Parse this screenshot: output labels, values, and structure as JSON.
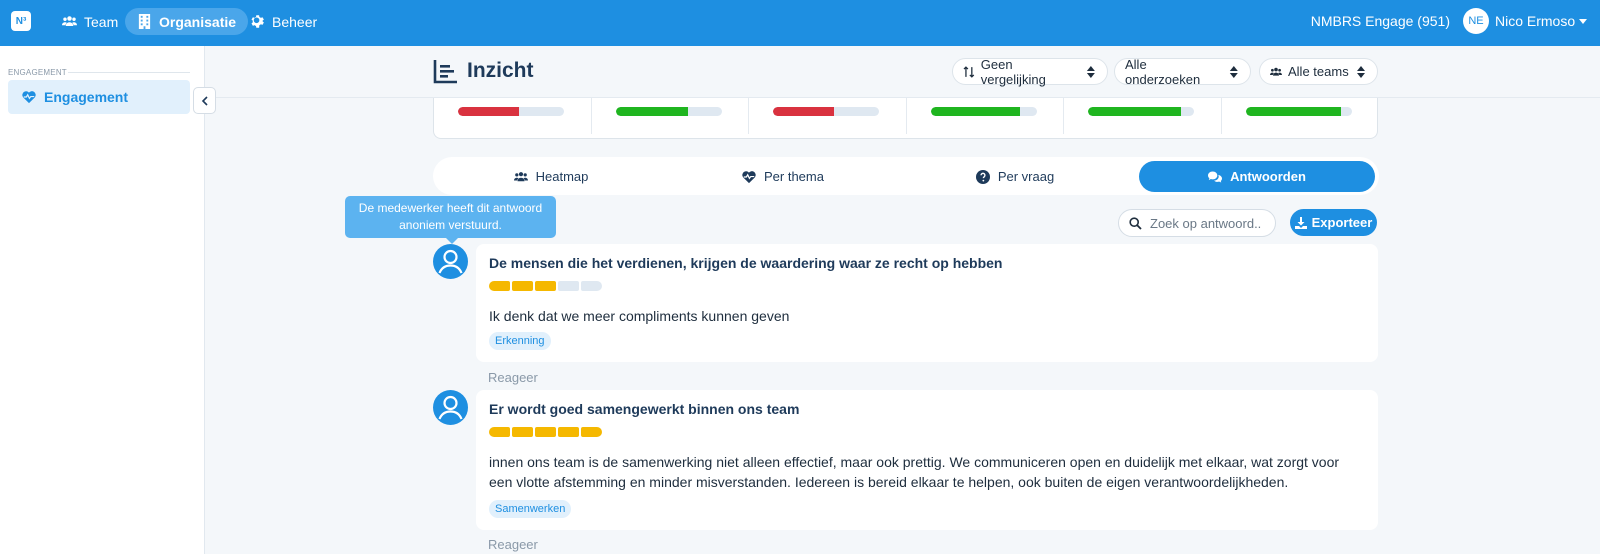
{
  "topbar": {
    "logo": "N³",
    "nav": [
      {
        "label": "Team",
        "icon": "users-icon",
        "active": false
      },
      {
        "label": "Organisatie",
        "icon": "building-icon",
        "active": true
      },
      {
        "label": "Beheer",
        "icon": "gear-icon",
        "active": false
      }
    ],
    "company": "NMBRS Engage (951)",
    "user_initials": "NE",
    "user_name": "Nico Ermoso"
  },
  "sidebar": {
    "section": "ENGAGEMENT",
    "items": [
      {
        "label": "Engagement",
        "icon": "heart-pulse-icon",
        "active": true
      }
    ]
  },
  "header": {
    "title": "Inzicht",
    "filters": [
      {
        "label": "Geen vergelijking",
        "icon": "sort-arrows-icon"
      },
      {
        "label": "Alle onderzoeken",
        "icon": ""
      },
      {
        "label": "Alle teams",
        "icon": "users-icon"
      }
    ]
  },
  "score_bars": [
    {
      "value": 0.58,
      "color": "#d9323f"
    },
    {
      "value": 0.68,
      "color": "#1fb51f"
    },
    {
      "value": 0.58,
      "color": "#d9323f"
    },
    {
      "value": 0.84,
      "color": "#1fb51f"
    },
    {
      "value": 0.88,
      "color": "#1fb51f"
    },
    {
      "value": 0.9,
      "color": "#1fb51f"
    }
  ],
  "tabs": [
    {
      "label": "Heatmap",
      "icon": "users-icon",
      "active": false
    },
    {
      "label": "Per thema",
      "icon": "heart-pulse-icon",
      "active": false
    },
    {
      "label": "Per vraag",
      "icon": "question-icon",
      "active": false
    },
    {
      "label": "Antwoorden",
      "icon": "comments-icon",
      "active": true
    }
  ],
  "tooltip": {
    "line1": "De medewerker heeft dit antwoord",
    "line2": "anoniem verstuurd."
  },
  "search": {
    "placeholder": "Zoek op antwoord.."
  },
  "export_label": "Exporteer",
  "answers": [
    {
      "question": "De mensen die het verdienen, krijgen de waardering waar ze recht op hebben",
      "rating": 3,
      "max": 5,
      "text": "Ik denk dat we meer compliments kunnen geven",
      "tag": "Erkenning",
      "reply": "Reageer"
    },
    {
      "question": "Er wordt goed samengewerkt binnen ons team",
      "rating": 5,
      "max": 5,
      "text": "innen ons team is de samenwerking niet alleen effectief, maar ook prettig. We communiceren open en duidelijk met elkaar, wat zorgt voor een vlotte afstemming en minder misverstanden. Iedereen is bereid elkaar te helpen, ook buiten de eigen verantwoordelijkheden.",
      "tag": "Samenwerken",
      "reply": "Reageer"
    }
  ],
  "colors": {
    "primary": "#1e8fe1",
    "star": "#f5b800",
    "bad": "#d9323f",
    "good": "#1fb51f"
  }
}
